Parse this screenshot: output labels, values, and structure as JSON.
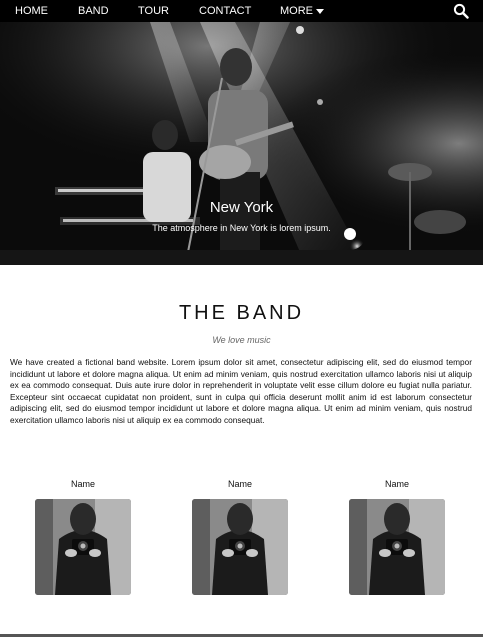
{
  "nav": {
    "items": [
      {
        "label": "HOME"
      },
      {
        "label": "BAND"
      },
      {
        "label": "TOUR"
      },
      {
        "label": "CONTACT"
      },
      {
        "label": "MORE"
      }
    ],
    "search_icon": "search-icon",
    "more_icon": "caret-down-icon"
  },
  "hero": {
    "title": "New York",
    "subtitle": "The atmosphere in New York is lorem ipsum."
  },
  "band": {
    "title": "THE BAND",
    "tagline": "We love music",
    "description": "We have created a fictional band website. Lorem ipsum dolor sit amet, consectetur adipiscing elit, sed do eiusmod tempor incididunt ut labore et dolore magna aliqua. Ut enim ad minim veniam, quis nostrud exercitation ullamco laboris nisi ut aliquip ex ea commodo consequat. Duis aute irure dolor in reprehenderit in voluptate velit esse cillum dolore eu fugiat nulla pariatur. Excepteur sint occaecat cupidatat non proident, sunt in culpa qui officia deserunt mollit anim id est laborum consectetur adipiscing elit, sed do eiusmod tempor incididunt ut labore et dolore magna aliqua. Ut enim ad minim veniam, quis nostrud exercitation ullamco laboris nisi ut aliquip ex ea commodo consequat.",
    "members": [
      {
        "name": "Name"
      },
      {
        "name": "Name"
      },
      {
        "name": "Name"
      }
    ]
  },
  "colors": {
    "navbar": "#000000",
    "hero_bg": "#0a0a0a",
    "text": "#111111",
    "tagline": "#666666"
  }
}
